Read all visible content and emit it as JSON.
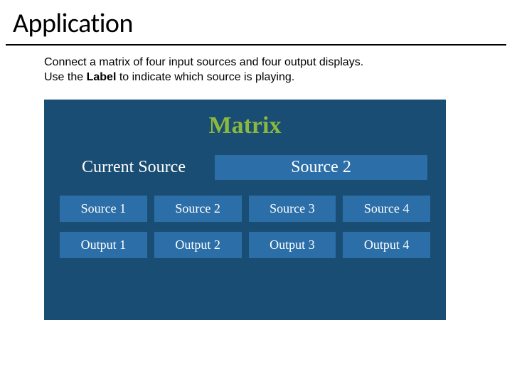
{
  "title": "Application",
  "description_line1": "Connect a matrix of four input sources and four output displays.",
  "description_line2_pre": "Use the ",
  "description_line2_bold": "Label",
  "description_line2_post": " to indicate which source is playing.",
  "panel": {
    "heading": "Matrix",
    "current_label": "Current Source",
    "current_value": "Source 2",
    "sources": [
      "Source 1",
      "Source 2",
      "Source 3",
      "Source 4"
    ],
    "outputs": [
      "Output 1",
      "Output 2",
      "Output 3",
      "Output 4"
    ]
  }
}
